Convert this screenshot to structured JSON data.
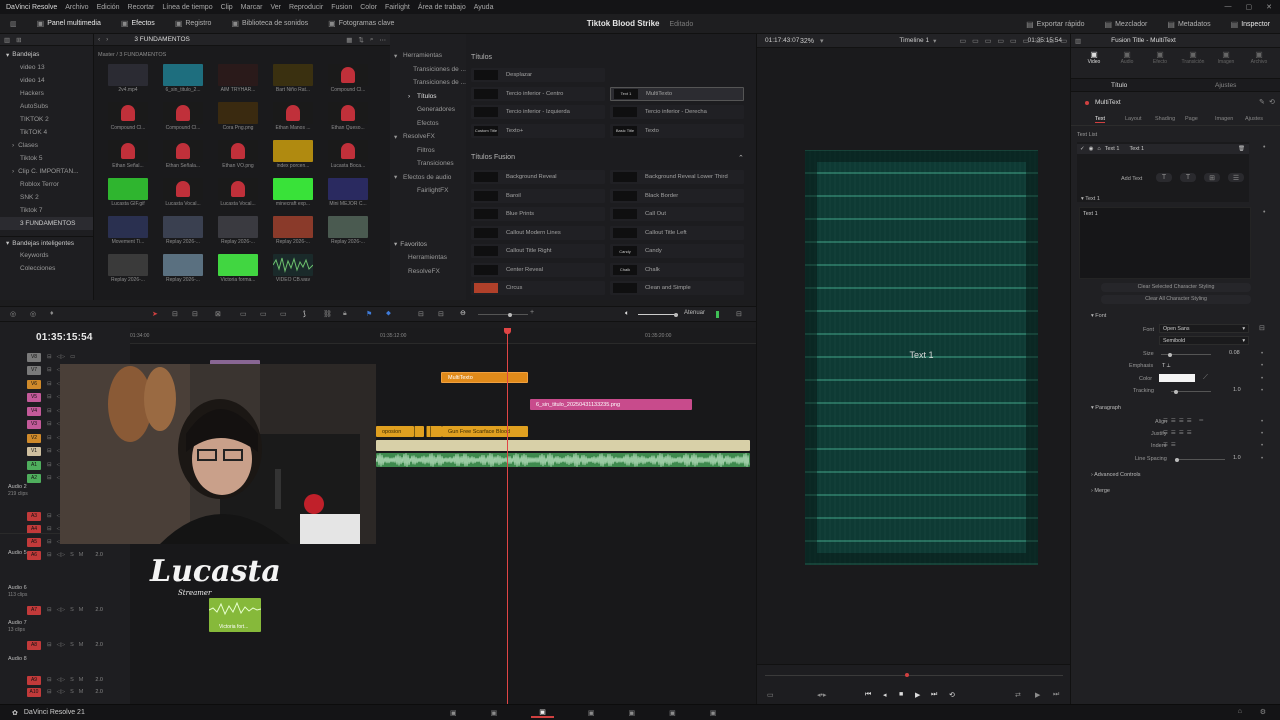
{
  "menu": [
    "DaVinci Resolve",
    "Archivo",
    "Edición",
    "Recortar",
    "Línea de tiempo",
    "Clip",
    "Marcar",
    "Ver",
    "Reproducir",
    "Fusion",
    "Color",
    "Fairlight",
    "Área de trabajo",
    "Ayuda"
  ],
  "toolbar": {
    "left": [
      {
        "label": "Panel multimedia",
        "icon": "media-pool-icon",
        "active": true
      },
      {
        "label": "Efectos",
        "icon": "effects-icon",
        "active": true
      },
      {
        "label": "Registro",
        "icon": "index-icon",
        "active": false
      },
      {
        "label": "Biblioteca de sonidos",
        "icon": "sound-library-icon",
        "active": false
      },
      {
        "label": "Fotogramas clave",
        "icon": "keyframes-icon",
        "active": false
      }
    ],
    "project_title": "Tiktok Blood Strike",
    "project_status": "Editado",
    "right": [
      {
        "label": "Exportar rápido",
        "icon": "quick-export-icon"
      },
      {
        "label": "Mezclador",
        "icon": "mixer-icon"
      },
      {
        "label": "Metadatos",
        "icon": "metadata-icon"
      },
      {
        "label": "Inspector",
        "icon": "inspector-icon"
      }
    ]
  },
  "bins": {
    "header": "Bandejas",
    "items": [
      "video 13",
      "video 14",
      "Hackers",
      "AutoSubs",
      "TIKTOK 2",
      "TikTOK 4",
      "Clases",
      "Tiktok 5",
      "Clip C. IMPORTAN...",
      "Roblox Terror",
      "SNK 2",
      "Tiktok 7",
      "3 FUNDAMENTOS"
    ],
    "smart_header": "Bandejas inteligentes",
    "smart_items": [
      "Keywords",
      "Colecciones"
    ]
  },
  "pool": {
    "breadcrumb": "3 FUNDAMENTOS",
    "path": "Master / 3 FUNDAMENTOS",
    "clips": [
      "2v4.mp4",
      "6_sin_titulo_2...",
      "AIM TRYHAR...",
      "Bart Niño Rat...",
      "Compound Cl...",
      "Compound Cl...",
      "Compound Cl...",
      "Cora Png.png",
      "Ethan Manos ...",
      "Ethan Queso...",
      "Ethan Señal...",
      "Ethan Señala...",
      "Ethan VO.png",
      "index porcen...",
      "Lucasta Boca...",
      "Lucasta GIF.gif",
      "Lucasta Vocal...",
      "Lucasta Vocal...",
      "minecraft exp...",
      "Mini MEJOR C...",
      "Movement Ti...",
      "Replay 2026-...",
      "Replay 2026-...",
      "Replay 2026-...",
      "Replay 2026-...",
      "Replay 2026-...",
      "Replay 2026-...",
      "Victoria forma...",
      "VIDEO CB.wav"
    ]
  },
  "effects_tree": {
    "items": [
      {
        "label": "Herramientas",
        "level": 0
      },
      {
        "label": "Transiciones de ...",
        "level": 1
      },
      {
        "label": "Transiciones de ...",
        "level": 1
      },
      {
        "label": "Títulos",
        "level": 1,
        "selected": true
      },
      {
        "label": "Generadores",
        "level": 1
      },
      {
        "label": "Efectos",
        "level": 1
      },
      {
        "label": "ResolveFX",
        "level": 0
      },
      {
        "label": "Filtros",
        "level": 1
      },
      {
        "label": "Transiciones",
        "level": 1
      },
      {
        "label": "Efectos de audio",
        "level": 0
      },
      {
        "label": "FairlightFX",
        "level": 1
      }
    ],
    "fav_header": "Favoritos",
    "fav_items": [
      "Herramientas",
      "ResolveFX"
    ]
  },
  "fx_list": {
    "titles_header": "Títulos",
    "titles": [
      {
        "label": "Desplazar",
        "preview": ""
      },
      {
        "label": "MultiTexto",
        "preview": "Text 1",
        "selected": true
      },
      {
        "label": "Tercio inferior - Centro",
        "preview": ""
      },
      {
        "label": "Tercio inferior - Derecha",
        "preview": ""
      },
      {
        "label": "Tercio inferior - Izquierda",
        "preview": ""
      },
      {
        "label": "Texto",
        "preview": "Basic Title"
      },
      {
        "label": "Texto+",
        "preview": "Custom Title"
      }
    ],
    "fusion_header": "Títulos Fusion",
    "fusion": [
      "Background Reveal",
      "Background Reveal Lower Third",
      "Baroil",
      "Black Border",
      "Blue Prints",
      "Call Out",
      "Callout Modern Lines",
      "Callout Title Left",
      "Callout Title Right",
      "Candy",
      "Center Reveal",
      "Chalk",
      "Circus",
      "Clean and Simple"
    ],
    "fusion_previews": [
      "",
      "",
      "",
      "",
      "",
      "",
      "",
      "",
      "",
      "Candy",
      "",
      "Chalk",
      "",
      ""
    ]
  },
  "timeline": {
    "timecode": "01:35:15:54",
    "ruler": [
      "01:34:00",
      "01:35:12:00",
      "01:35:20:00"
    ],
    "tracks": [
      {
        "id": "V8",
        "color": "#7a7a7a",
        "kind": "v"
      },
      {
        "id": "V7",
        "color": "#7a7a7a",
        "kind": "v"
      },
      {
        "id": "V6",
        "color": "#d08a2a",
        "kind": "v"
      },
      {
        "id": "V5",
        "color": "#c45a9a",
        "kind": "v"
      },
      {
        "id": "V4",
        "color": "#c45a9a",
        "kind": "v"
      },
      {
        "id": "V3",
        "color": "#c45a9a",
        "kind": "v"
      },
      {
        "id": "V2",
        "color": "#d08a2a",
        "kind": "v"
      },
      {
        "id": "V1",
        "color": "#d0c0a0",
        "kind": "v"
      },
      {
        "id": "A1",
        "color": "#4fae5d",
        "kind": "a"
      },
      {
        "id": "A2",
        "color": "#4fae5d",
        "kind": "a"
      }
    ],
    "audio_tracks": [
      {
        "name": "Audio 2",
        "sub": "219 clips",
        "id": "A3",
        "level": ""
      },
      {
        "name": "",
        "sub": "",
        "id": "A4",
        "level": ""
      },
      {
        "name": "",
        "sub": "",
        "id": "A5",
        "level": ""
      },
      {
        "name": "Audio 5",
        "sub": "",
        "id": "A6",
        "level": "2.0"
      },
      {
        "name": "Audio 6",
        "sub": "113 clips",
        "id": "A7",
        "level": "2.0"
      },
      {
        "name": "Audio 7",
        "sub": "13 clips",
        "id": "A8",
        "level": "2.0"
      },
      {
        "name": "Audio 8",
        "sub": "",
        "id": "A9",
        "level": "2.0"
      },
      {
        "name": "",
        "sub": "",
        "id": "A10",
        "level": "2.0"
      }
    ],
    "clips": {
      "multitext": "MultiTexto",
      "png": "6_sin_titulo_20250431133235.png",
      "v2a": "oposion",
      "v2b": "Gun Free Scarface Blood",
      "v9": "Victoria forma...",
      "overlay_clip": "Victoria fort..."
    },
    "mute_label": "Atenuar",
    "logo_text": "Lucasta",
    "logo_sub": "Streamer"
  },
  "viewer": {
    "timecode": "01:17:43:07",
    "zoom": "32%",
    "timeline_name": "Timeline 1",
    "end_timecode": "01:35:15:54",
    "canvas_text": "Text 1"
  },
  "inspector": {
    "title": "Fusion Title - MultiText",
    "top_tabs": [
      "Video",
      "Audio",
      "Efecto",
      "Transición",
      "Imagen",
      "Archivo"
    ],
    "sub_tabs": [
      "Título",
      "Ajustes"
    ],
    "section": "MultiText",
    "text_tabs": [
      "Text",
      "Layout",
      "Shading",
      "Page",
      "Imagen",
      "Ajustes"
    ],
    "text_list_label": "Text List",
    "text_entry": "Text 1",
    "text_entry_value": "Text 1",
    "add_text": "Add Text",
    "text_group": "Text 1",
    "text_value": "Text 1",
    "clear_selected": "Clear Selected Character Styling",
    "clear_all": "Clear All Character Styling",
    "font_header": "Font",
    "font_label": "Font",
    "font_value": "Open Sans",
    "style_value": "Semibold",
    "size_label": "Size",
    "size_value": "0.08",
    "emphasis_label": "Emphasis",
    "color_label": "Color",
    "tracking_label": "Tracking",
    "tracking_value": "1.0",
    "paragraph_header": "Paragraph",
    "align_label": "Align",
    "justify_label": "Justify",
    "indent_label": "Indent",
    "line_spacing_label": "Line Spacing",
    "line_spacing_value": "1.0",
    "advanced": "Advanced Controls",
    "merge": "Merge"
  },
  "bottom": {
    "app": "DaVinci Resolve 21"
  }
}
